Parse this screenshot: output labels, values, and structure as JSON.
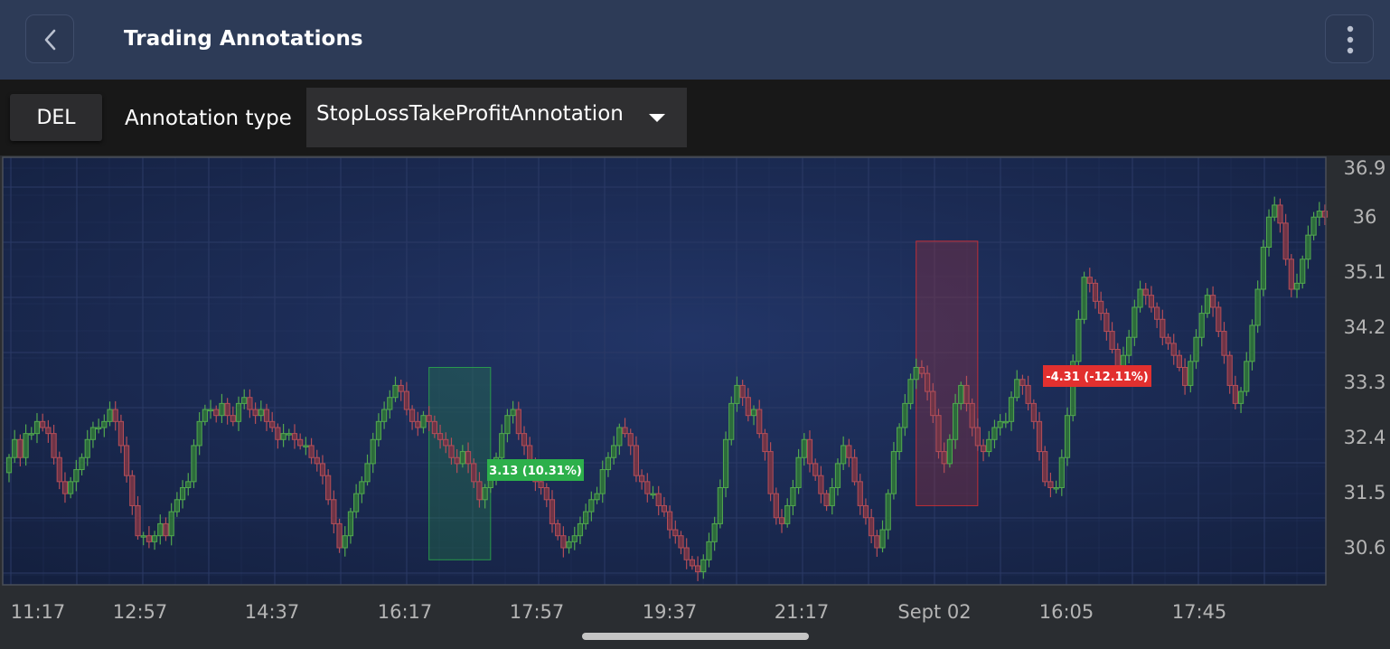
{
  "header": {
    "title": "Trading Annotations",
    "back_icon": "chevron-left-icon",
    "menu_icon": "more-vertical-icon"
  },
  "toolbar": {
    "delete_label": "DEL",
    "annotation_type_label": "Annotation type",
    "annotation_type_value": "StopLossTakeProfitAnnotation",
    "dropdown_icon": "caret-down-icon"
  },
  "chart_data": {
    "type": "candlestick",
    "x_tick_labels": [
      "11:17",
      "12:57",
      "14:37",
      "16:17",
      "17:57",
      "19:37",
      "21:17",
      "Sept 02",
      "16:05",
      "17:45"
    ],
    "y_tick_labels": [
      "36.9",
      "36",
      "35.1",
      "34.2",
      "33.3",
      "32.4",
      "31.5",
      "30.6"
    ],
    "ylim": [
      30.1,
      37.0
    ],
    "grid": true,
    "close": [
      32.1,
      32.4,
      32.1,
      32.5,
      32.5,
      32.7,
      32.6,
      32.5,
      32.1,
      31.7,
      31.5,
      31.7,
      31.9,
      32.1,
      32.4,
      32.6,
      32.6,
      32.7,
      32.9,
      32.7,
      32.3,
      31.8,
      31.3,
      30.8,
      30.8,
      30.7,
      30.8,
      31.0,
      30.8,
      31.2,
      31.4,
      31.6,
      31.7,
      32.3,
      32.7,
      32.9,
      32.9,
      32.8,
      33.0,
      32.8,
      32.7,
      33.0,
      33.1,
      32.9,
      32.8,
      32.9,
      32.7,
      32.6,
      32.4,
      32.5,
      32.5,
      32.4,
      32.3,
      32.3,
      32.1,
      32.0,
      31.8,
      31.4,
      31.0,
      30.6,
      30.8,
      31.2,
      31.5,
      31.7,
      32.0,
      32.4,
      32.7,
      32.9,
      33.1,
      33.3,
      33.2,
      32.9,
      32.7,
      32.6,
      32.8,
      32.7,
      32.5,
      32.4,
      32.3,
      32.1,
      32.0,
      32.2,
      32.0,
      31.7,
      31.4,
      31.6,
      31.8,
      32.1,
      32.5,
      32.8,
      32.9,
      32.5,
      32.3,
      32.0,
      31.7,
      31.6,
      31.4,
      31.0,
      30.8,
      30.6,
      30.7,
      30.8,
      31.0,
      31.2,
      31.4,
      31.5,
      31.9,
      32.1,
      32.3,
      32.6,
      32.5,
      32.3,
      31.8,
      31.7,
      31.5,
      31.5,
      31.3,
      31.2,
      30.9,
      30.8,
      30.6,
      30.4,
      30.3,
      30.2,
      30.4,
      30.7,
      31.0,
      31.6,
      32.4,
      33.0,
      33.3,
      33.1,
      32.8,
      32.9,
      32.5,
      32.2,
      31.5,
      31.1,
      31.0,
      31.3,
      31.6,
      32.1,
      32.4,
      32.0,
      31.8,
      31.5,
      31.3,
      31.6,
      32.0,
      32.3,
      32.1,
      31.7,
      31.3,
      31.1,
      30.8,
      30.6,
      30.9,
      31.5,
      32.2,
      32.6,
      33.0,
      33.4,
      33.6,
      33.5,
      33.2,
      32.8,
      32.2,
      32.0,
      32.4,
      33.0,
      33.3,
      33.0,
      32.6,
      32.3,
      32.2,
      32.4,
      32.6,
      32.7,
      32.7,
      33.1,
      33.4,
      33.3,
      33.0,
      32.7,
      32.2,
      31.7,
      31.6,
      31.6,
      32.1,
      32.8,
      33.7,
      34.4,
      35.1,
      35.0,
      34.7,
      34.5,
      34.2,
      33.9,
      33.6,
      33.8,
      34.1,
      34.6,
      34.9,
      34.8,
      34.6,
      34.4,
      34.1,
      34.0,
      33.8,
      33.6,
      33.3,
      33.7,
      34.1,
      34.5,
      34.8,
      34.6,
      34.2,
      33.8,
      33.3,
      33.0,
      33.2,
      33.7,
      34.3,
      34.9,
      35.6,
      36.1,
      36.3,
      36.0,
      35.4,
      34.9,
      35.0,
      35.4,
      35.8,
      36.1,
      36.2,
      36.1
    ],
    "annotations": [
      {
        "kind": "take-profit",
        "label": "3.13 (10.31%)",
        "color": "#2db04b",
        "x_start": 75,
        "x_end": 86,
        "y_low": 30.4,
        "y_high": 33.6
      },
      {
        "kind": "stop-loss",
        "label": "-4.31 (-12.11%)",
        "color": "#e2302f",
        "x_start": 162,
        "x_end": 173,
        "y_low": 31.3,
        "y_high": 35.7
      }
    ],
    "colors": {
      "up": "#52a84f",
      "down": "#b44e58",
      "up_fill": "#2c6b3c",
      "down_fill": "#6d3447",
      "background": "#1b2a52",
      "grid": "#2b3a66",
      "axis_text": "#b4b4b4"
    }
  }
}
